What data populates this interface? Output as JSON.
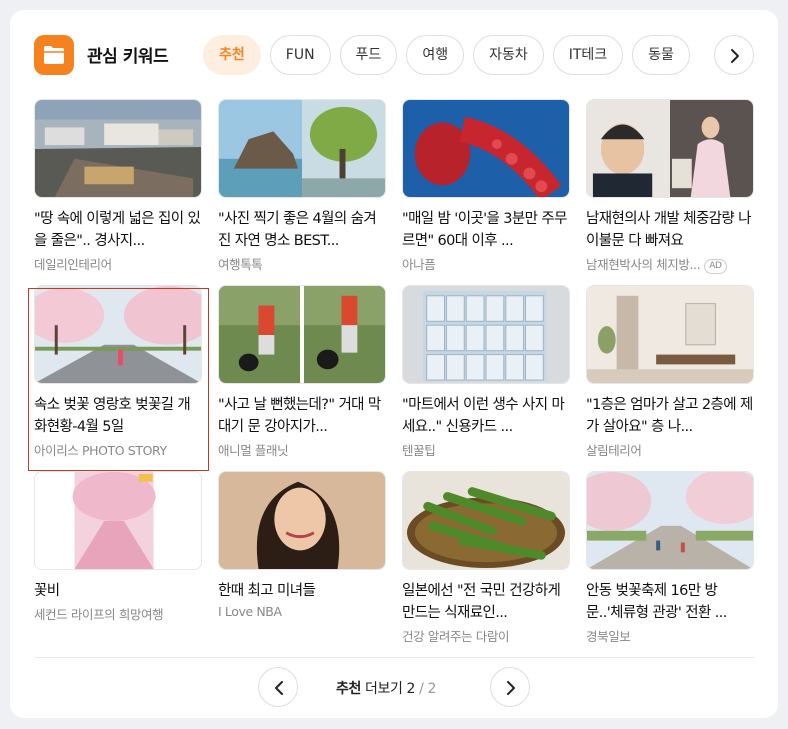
{
  "header": {
    "title": "관심 키워드"
  },
  "chips": [
    "추천",
    "FUN",
    "푸드",
    "여행",
    "자동차",
    "IT테크",
    "동물"
  ],
  "items": [
    {
      "headline": "\"땅 속에 이렇게 넓은 집이 있을 줄은\".. 경사지...",
      "source": "데일리인테리어"
    },
    {
      "headline": "\"사진 찍기 좋은 4월의 숨겨진 자연 명소 BEST...",
      "source": "여행톡톡"
    },
    {
      "headline": "\"매일 밤 '이곳'을 3분만 주무르면\" 60대 이후 ...",
      "source": "아나픔"
    },
    {
      "headline": "남재현의사 개발 체중감량 나이불문 다 빠져요",
      "source": "남재현박사의 체지방...",
      "badge": "AD"
    },
    {
      "headline": "속소 벚꽃 영랑호 벚꽃길 개화현황-4월 5일",
      "source": "아이리스 PHOTO STORY"
    },
    {
      "headline": "\"사고 날 뻔했는데?\" 거대 막대기 문 강아지가...",
      "source": "애니멀 플래닛"
    },
    {
      "headline": "\"마트에서 이런 생수 사지 마세요..\" 신용카드 ...",
      "source": "텐꿀팁"
    },
    {
      "headline": "\"1층은 엄마가 살고 2층에 제가 살아요\" 층 나...",
      "source": "살림테리어"
    },
    {
      "headline": "꽃비",
      "source": "세컨드 라이프의 희망여행"
    },
    {
      "headline": "한때 최고 미녀들",
      "source": "I Love NBA"
    },
    {
      "headline": "일본에선 \"전 국민 건강하게 만드는 식재료인...",
      "source": "건강 알려주는 다람이"
    },
    {
      "headline": "안동 벚꽃축제 16만 방문..'체류형 관광' 전환 ...",
      "source": "경북일보"
    }
  ],
  "pager": {
    "label": "추천",
    "more": "더보기",
    "current": "2",
    "sep": "/",
    "total": "2"
  }
}
